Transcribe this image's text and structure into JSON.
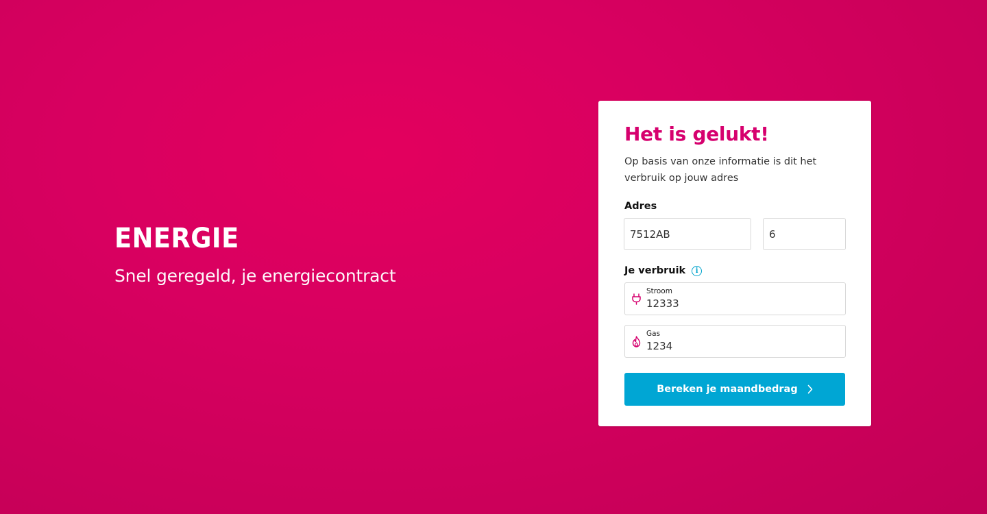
{
  "hero": {
    "title": "ENERGIE",
    "subtitle": "Snel geregeld, je energiecontract"
  },
  "card": {
    "title": "Het is gelukt!",
    "intro": "Op basis van onze informatie is dit het verbruik op jouw adres",
    "address": {
      "label": "Adres",
      "postcode": "7512AB",
      "house_number": "6"
    },
    "usage": {
      "label": "Je verbruik",
      "info_icon": "info-icon",
      "stroom": {
        "label": "Stroom",
        "value": "12333",
        "icon": "plug-icon"
      },
      "gas": {
        "label": "Gas",
        "value": "1234",
        "icon": "flame-icon"
      }
    },
    "submit_label": "Bereken je maandbedrag",
    "submit_icon": "chevron-right-icon"
  },
  "colors": {
    "background": "#d80060",
    "accent": "#d6006e",
    "button": "#00a6d4",
    "info": "#00a3cc"
  }
}
